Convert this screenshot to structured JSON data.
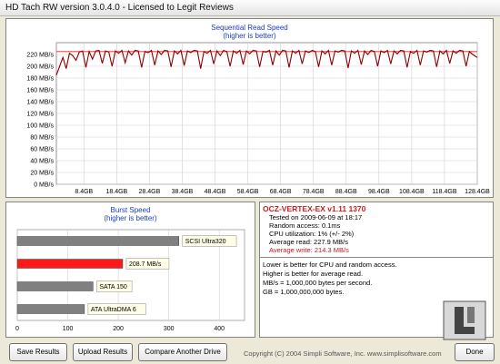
{
  "window": {
    "title": "HD Tach RW version 3.0.4.0 - Licensed to Legit Reviews"
  },
  "sequential": {
    "title": "Sequential Read Speed",
    "subtitle": "(higher is better)"
  },
  "burst": {
    "title": "Burst Speed",
    "subtitle": "(higher is better)",
    "bars": [
      {
        "label": "SCSI Ultra320",
        "value": 320,
        "color": "#808080"
      },
      {
        "label": "208.7 MB/s",
        "value": 208.7,
        "color": "#ff1a1a"
      },
      {
        "label": "SATA 150",
        "value": 150,
        "color": "#808080"
      },
      {
        "label": "ATA UltraDMA 6",
        "value": 133,
        "color": "#808080"
      }
    ],
    "x_ticks": [
      "0",
      "100",
      "200",
      "300",
      "400"
    ]
  },
  "info": {
    "drive": "OCZ-VERTEX-EX v1.11 1370",
    "tested_on": "Tested on 2009-06-09 at 18:17",
    "random_access": "Random access: 0.1ms",
    "cpu": "CPU utilization: 1% (+/- 2%)",
    "avg_read": "Average read: 227.9 MB/s",
    "avg_write": "Average write: 214.3 MB/s",
    "note1": "Lower is better for CPU and random access.",
    "note2": "Higher is better for average read.",
    "note3": "MB/s = 1,000,000 bytes per second.",
    "note4": "GB = 1,000,000,000 bytes."
  },
  "buttons": {
    "save": "Save Results",
    "upload": "Upload Results",
    "compare": "Compare Another Drive",
    "exit": "Done"
  },
  "copyright": "Copyright (C) 2004 Simpli Software, Inc. www.simplisoftware.com",
  "colors": {
    "read_line": "#8b0000",
    "write_line": "#ff5a5a",
    "grid": "#d0d0d0",
    "title_blue": "#1b3dbf"
  },
  "chart_data": [
    {
      "type": "line",
      "title": "Sequential Read Speed",
      "subtitle": "(higher is better)",
      "ylim": [
        0,
        240
      ],
      "y_ticks": [
        "0 MB/s",
        "20 MB/s",
        "40 MB/s",
        "60 MB/s",
        "80 MB/s",
        "100 MB/s",
        "120 MB/s",
        "140 MB/s",
        "160 MB/s",
        "180 MB/s",
        "200 MB/s",
        "220 MB/s"
      ],
      "x_ticks": [
        "8.4GB",
        "18.4GB",
        "28.4GB",
        "38.4GB",
        "48.4GB",
        "58.4GB",
        "68.4GB",
        "78.4GB",
        "88.4GB",
        "98.4GB",
        "108.4GB",
        "118.4GB",
        "128.4GB"
      ],
      "xlim": [
        0,
        128.4
      ],
      "grid": true,
      "series": [
        {
          "x": [
            0,
            1,
            2,
            3,
            4,
            5,
            6,
            7,
            8,
            9,
            10,
            11,
            12,
            13,
            14,
            15,
            16,
            17,
            18,
            19,
            20,
            21,
            22,
            23,
            24,
            25,
            26,
            27,
            28,
            29,
            30,
            31,
            32,
            33,
            34,
            35,
            36,
            37,
            38,
            39,
            40,
            41,
            42,
            43,
            44,
            45,
            46,
            47,
            48,
            49,
            50,
            51,
            52,
            53,
            54,
            55,
            56,
            57,
            58,
            59,
            60,
            61,
            62,
            63,
            64,
            65,
            66,
            67,
            68,
            69,
            70,
            71,
            72,
            73,
            74,
            75,
            76,
            77,
            78,
            79,
            80,
            81,
            82,
            83,
            84,
            85,
            86,
            87,
            88,
            89,
            90,
            91,
            92,
            93,
            94,
            95,
            96,
            97,
            98,
            99,
            100,
            101,
            102,
            103,
            104,
            105,
            106,
            107,
            108,
            109,
            110,
            111,
            112,
            113,
            114,
            115,
            116,
            117,
            118,
            119,
            120,
            121,
            122,
            123,
            124,
            125,
            126,
            127,
            128.4
          ],
          "values": [
            185,
            200,
            215,
            196,
            222,
            218,
            210,
            224,
            226,
            198,
            225,
            212,
            226,
            227,
            205,
            226,
            224,
            200,
            226,
            222,
            227,
            206,
            226,
            219,
            227,
            226,
            198,
            225,
            223,
            227,
            202,
            226,
            220,
            227,
            226,
            199,
            226,
            221,
            227,
            201,
            226,
            223,
            227,
            226,
            196,
            225,
            222,
            227,
            204,
            226,
            218,
            227,
            225,
            200,
            226,
            222,
            227,
            203,
            226,
            221,
            227,
            226,
            199,
            225,
            224,
            227,
            202,
            226,
            219,
            227,
            226,
            198,
            226,
            222,
            227,
            204,
            226,
            223,
            227,
            225,
            199,
            226,
            221,
            227,
            202,
            226,
            224,
            227,
            226,
            197,
            226,
            222,
            227,
            203,
            226,
            220,
            227,
            225,
            200,
            226,
            223,
            227,
            204,
            226,
            221,
            227,
            226,
            198,
            225,
            222,
            227,
            202,
            226,
            224,
            227,
            226,
            199,
            226,
            221,
            227,
            205,
            226,
            222,
            227,
            226,
            200,
            225,
            220,
            215
          ]
        },
        {
          "x": [
            0,
            128.4
          ],
          "values": [
            225,
            225
          ]
        }
      ]
    },
    {
      "type": "bar",
      "title": "Burst Speed",
      "subtitle": "(higher is better)",
      "orientation": "horizontal",
      "categories": [
        "SCSI Ultra320",
        "208.7 MB/s",
        "SATA 150",
        "ATA UltraDMA 6"
      ],
      "values": [
        320,
        208.7,
        150,
        133
      ],
      "xlim": [
        0,
        450
      ],
      "x_ticks": [
        "0",
        "100",
        "200",
        "300",
        "400"
      ]
    }
  ]
}
